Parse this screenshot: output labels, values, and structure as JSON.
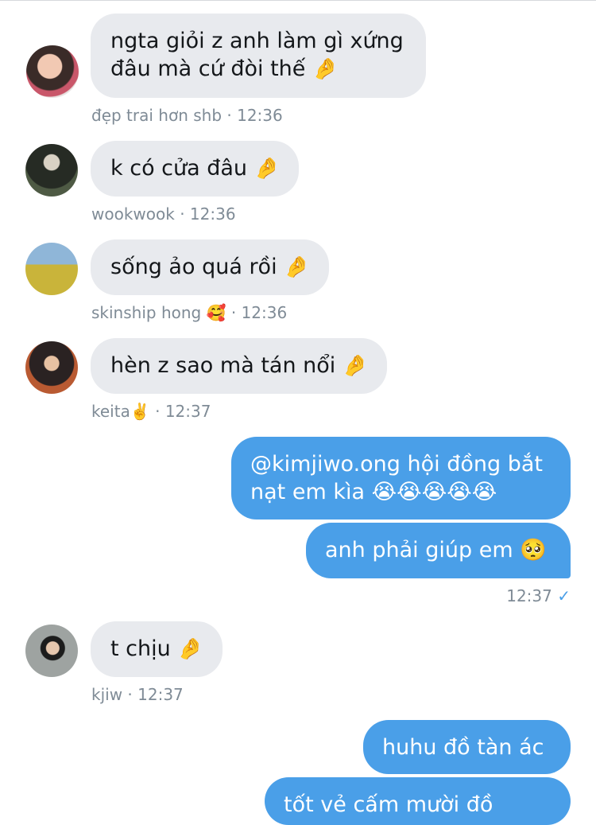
{
  "messages": [
    {
      "type": "incoming",
      "text": "ngta giỏi z anh làm gì xứng đâu mà cứ đòi thế",
      "emoji": "🤌",
      "sender": "đẹp trai hơn shb",
      "time": "12:36",
      "avatar_icon": "avatar-photo-icon"
    },
    {
      "type": "incoming",
      "text": "k có cửa đâu",
      "emoji": "🤌",
      "sender": "wookwook",
      "time": "12:36",
      "avatar_icon": "avatar-photo-icon"
    },
    {
      "type": "incoming",
      "text": "sống ảo quá rồi",
      "emoji": "🤌",
      "sender": "skinship hong",
      "sender_emoji": "🥰",
      "time": "12:36",
      "avatar_icon": "avatar-photo-icon"
    },
    {
      "type": "incoming",
      "text": "hèn z sao mà tán nổi",
      "emoji": "🤌",
      "sender": "keita",
      "sender_emoji": "✌️",
      "time": "12:37",
      "avatar_icon": "avatar-photo-icon"
    },
    {
      "type": "outgoing",
      "text": "@kimjiwo.ong hội đồng bắt nạt em kìa",
      "emoji": "😭😭😭😭😭"
    },
    {
      "type": "outgoing",
      "text": "anh phải giúp em",
      "emoji": "🥺",
      "time": "12:37",
      "status": "✓"
    },
    {
      "type": "incoming",
      "text": "t chịu",
      "emoji": "🤌",
      "sender": "kjiw",
      "time": "12:37",
      "avatar_icon": "avatar-photo-icon"
    },
    {
      "type": "outgoing",
      "text": "huhu đồ tàn ác"
    },
    {
      "type": "outgoing",
      "text": "tốt vẻ cấm mười đồ",
      "partial": true
    }
  ],
  "meta_separator": "·",
  "colors": {
    "incoming_bubble": "#e8eaee",
    "outgoing_bubble": "#4a9fe8",
    "meta_text": "#7f8b96",
    "read_check": "#4a9fe8"
  }
}
